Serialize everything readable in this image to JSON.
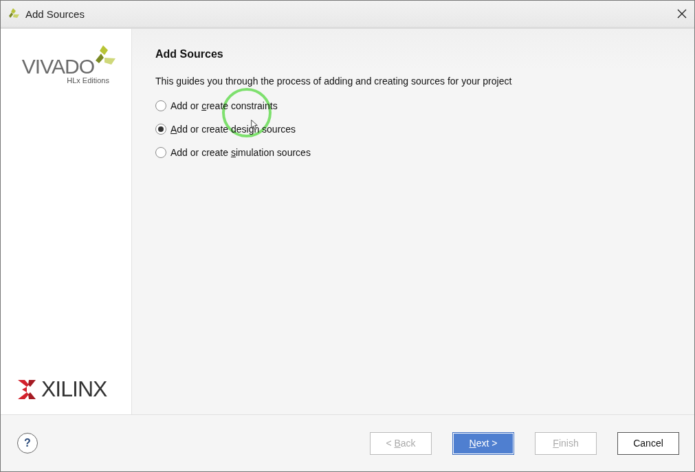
{
  "window": {
    "title": "Add Sources"
  },
  "sidebar": {
    "logo_top": {
      "name": "VIVADO",
      "subtitle": "HLx Editions"
    },
    "logo_bottom": {
      "name": "XILINX"
    }
  },
  "heading": "Add Sources",
  "description": "This guides you through the process of adding and creating sources for your project",
  "options": [
    {
      "label": [
        {
          "text": "Add or "
        },
        {
          "text": "c",
          "mnemonic": true
        },
        {
          "text": "reate constraints"
        }
      ],
      "selected": false
    },
    {
      "label": [
        {
          "text": "A",
          "mnemonic": true
        },
        {
          "text": "dd or create design sources"
        }
      ],
      "selected": true
    },
    {
      "label": [
        {
          "text": "Add or create "
        },
        {
          "text": "s",
          "mnemonic": true
        },
        {
          "text": "imulation sources"
        }
      ],
      "selected": false
    }
  ],
  "help": {
    "label": "?"
  },
  "buttons": [
    {
      "label": [
        {
          "text": "< "
        },
        {
          "text": "B",
          "mnemonic": true
        },
        {
          "text": "ack"
        }
      ],
      "disabled": true,
      "default": false
    },
    {
      "label": [
        {
          "text": "N",
          "mnemonic": true
        },
        {
          "text": "ext >"
        }
      ],
      "disabled": false,
      "default": true
    },
    {
      "label": [
        {
          "text": "F",
          "mnemonic": true
        },
        {
          "text": "inish"
        }
      ],
      "disabled": true,
      "default": false
    },
    {
      "label": [
        {
          "text": "Cancel"
        }
      ],
      "disabled": false,
      "default": false
    }
  ]
}
